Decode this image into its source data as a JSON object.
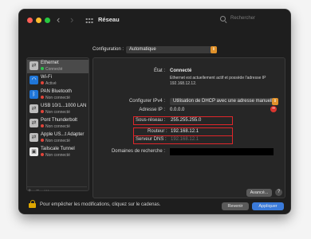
{
  "window": {
    "title": "Réseau",
    "search_placeholder": "Rechercher"
  },
  "config": {
    "label": "Configuration :",
    "value": "Automatique"
  },
  "sidebar": {
    "items": [
      {
        "name": "Ethernet",
        "status": "Connecté",
        "status_color": "green",
        "icon": "ethernet-icon",
        "glyph": "⇄"
      },
      {
        "name": "Wi-Fi",
        "status": "Activé",
        "status_color": "red",
        "icon": "wifi-icon",
        "glyph": "◠"
      },
      {
        "name": "PAN Bluetooth",
        "status": "Non connecté",
        "status_color": "red",
        "icon": "bluetooth-icon",
        "glyph": "ᛒ"
      },
      {
        "name": "USB 10/1...1000 LAN",
        "status": "Non connecté",
        "status_color": "red",
        "icon": "ethernet-icon",
        "glyph": "⇄"
      },
      {
        "name": "Pont Thunderbolt",
        "status": "Non connecté",
        "status_color": "red",
        "icon": "thunderbolt-icon",
        "glyph": "⇄"
      },
      {
        "name": "Apple US...t Adapter",
        "status": "Non connecté",
        "status_color": "red",
        "icon": "ethernet-icon",
        "glyph": "⇄"
      },
      {
        "name": "Tailscale Tunnel",
        "status": "Non connecté",
        "status_color": "red",
        "icon": "vpn-icon",
        "glyph": "▣"
      }
    ],
    "add_label": "+",
    "remove_label": "−",
    "action_label": "⋯"
  },
  "detail": {
    "status_label": "État :",
    "status_value": "Connecté",
    "status_desc_line1": "Ethernet est actuellement actif et possède l'adresse IP",
    "status_desc_line2": "192.168.12.12.",
    "ipv4_label": "Configurer IPv4 :",
    "ipv4_value": "Utilisation de DHCP avec une adresse manuelle",
    "ip_label": "Adresse IP :",
    "ip_value": "0.0.0.0",
    "subnet_label": "Sous-réseau :",
    "subnet_value": "255.255.255.0",
    "router_label": "Routeur :",
    "router_value": "192.168.12.1",
    "dns_label": "Serveur DNS :",
    "dns_value": "192.168.12.1",
    "search_domains_label": "Domaines de recherche :",
    "advanced_label": "Avancé...",
    "help_label": "?"
  },
  "footer": {
    "lock_text": "Pour empêcher les modifications, cliquez sur le cadenas.",
    "revert_label": "Revenir",
    "apply_label": "Appliquer"
  },
  "colors": {
    "accent": "#3a7ad9",
    "select_arrow": "#e0912a",
    "highlight_border": "#e0262a",
    "status_green": "#2fc24f",
    "status_red": "#e0443a"
  }
}
